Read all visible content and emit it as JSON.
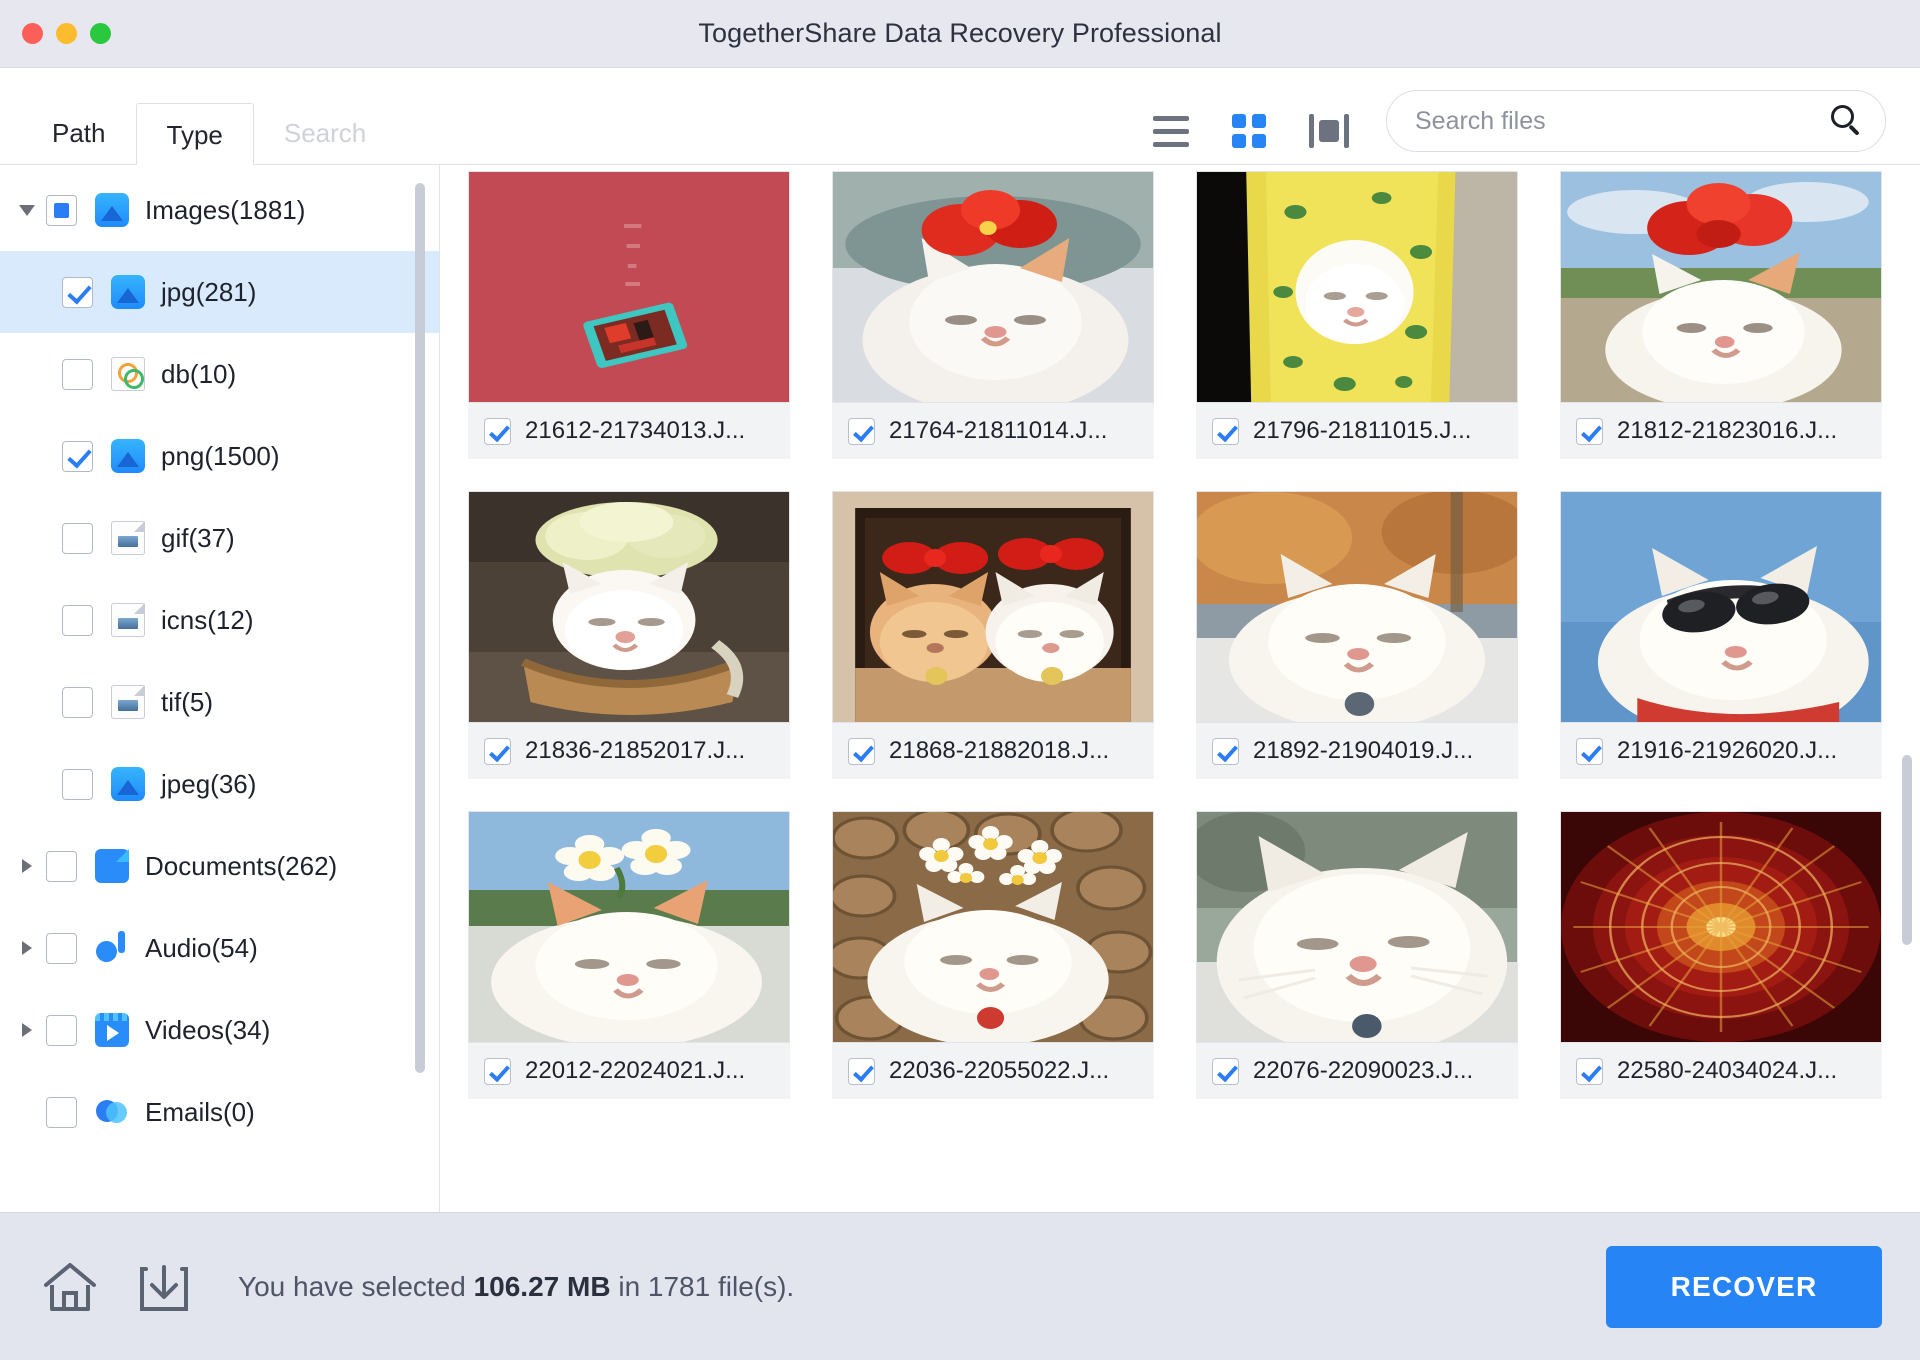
{
  "window": {
    "title": "TogetherShare Data Recovery Professional",
    "traffic_lights": [
      "close-red",
      "minimize-yellow",
      "maximize-green"
    ]
  },
  "toolbar": {
    "tabs": [
      {
        "label": "Path",
        "active": false,
        "muted": false
      },
      {
        "label": "Type",
        "active": true,
        "muted": false
      },
      {
        "label": "Search",
        "active": false,
        "muted": true
      }
    ],
    "view_modes": [
      {
        "name": "list-view-icon",
        "active": false
      },
      {
        "name": "grid-view-icon",
        "active": true
      },
      {
        "name": "cover-view-icon",
        "active": false
      }
    ],
    "search": {
      "placeholder": "Search files",
      "value": ""
    }
  },
  "sidebar": {
    "items": [
      {
        "label": "Images(1881)",
        "indent": 0,
        "twisty": "open",
        "check": "partial",
        "icon": "image-icon",
        "selected": false
      },
      {
        "label": "jpg(281)",
        "indent": 1,
        "twisty": "none",
        "check": "checked",
        "icon": "image-icon",
        "selected": true
      },
      {
        "label": "db(10)",
        "indent": 1,
        "twisty": "none",
        "check": "none",
        "icon": "db-icon",
        "selected": false
      },
      {
        "label": "png(1500)",
        "indent": 1,
        "twisty": "none",
        "check": "checked",
        "icon": "image-icon",
        "selected": false
      },
      {
        "label": "gif(37)",
        "indent": 1,
        "twisty": "none",
        "check": "none",
        "icon": "file-image-icon",
        "selected": false
      },
      {
        "label": "icns(12)",
        "indent": 1,
        "twisty": "none",
        "check": "none",
        "icon": "file-image-icon",
        "selected": false
      },
      {
        "label": "tif(5)",
        "indent": 1,
        "twisty": "none",
        "check": "none",
        "icon": "file-image-icon",
        "selected": false
      },
      {
        "label": "jpeg(36)",
        "indent": 1,
        "twisty": "none",
        "check": "none",
        "icon": "image-icon",
        "selected": false
      },
      {
        "label": "Documents(262)",
        "indent": 0,
        "twisty": "closed",
        "check": "none",
        "icon": "document-icon",
        "selected": false
      },
      {
        "label": "Audio(54)",
        "indent": 0,
        "twisty": "closed",
        "check": "none",
        "icon": "audio-icon",
        "selected": false
      },
      {
        "label": "Videos(34)",
        "indent": 0,
        "twisty": "closed",
        "check": "none",
        "icon": "video-icon",
        "selected": false
      },
      {
        "label": "Emails(0)",
        "indent": 0,
        "twisty": "none",
        "check": "none",
        "icon": "email-icon",
        "selected": false
      }
    ]
  },
  "files": [
    {
      "name": "21612-21734013.J...",
      "checked": true,
      "thumb": "red-card"
    },
    {
      "name": "21764-21811014.J...",
      "checked": true,
      "thumb": "cat-red-flower"
    },
    {
      "name": "21796-21811015.J...",
      "checked": true,
      "thumb": "cat-yellow-scarf"
    },
    {
      "name": "21812-21823016.J...",
      "checked": true,
      "thumb": "cat-hibiscus-sky"
    },
    {
      "name": "21836-21852017.J...",
      "checked": true,
      "thumb": "cat-cabbage-basket"
    },
    {
      "name": "21868-21882018.J...",
      "checked": true,
      "thumb": "two-cats-bows"
    },
    {
      "name": "21892-21904019.J...",
      "checked": true,
      "thumb": "cat-autumn"
    },
    {
      "name": "21916-21926020.J...",
      "checked": true,
      "thumb": "cat-sunglasses"
    },
    {
      "name": "22012-22024021.J...",
      "checked": true,
      "thumb": "cat-daffodil"
    },
    {
      "name": "22036-22055022.J...",
      "checked": true,
      "thumb": "cat-daisies-logs"
    },
    {
      "name": "22076-22090023.J...",
      "checked": true,
      "thumb": "cat-closeup"
    },
    {
      "name": "22580-24034024.J...",
      "checked": true,
      "thumb": "red-mandala"
    }
  ],
  "statusbar": {
    "home_icon": "home-icon",
    "download_icon": "download-icon",
    "text_prefix": "You have selected ",
    "size": "106.27 MB",
    "text_middle": " in 1781 file(s).",
    "recover_label": "RECOVER"
  },
  "colors": {
    "accent": "#2684f5",
    "titlebar": "#e6e7ef",
    "statusbar": "#e2e4ee",
    "selection": "#d9eafc"
  }
}
